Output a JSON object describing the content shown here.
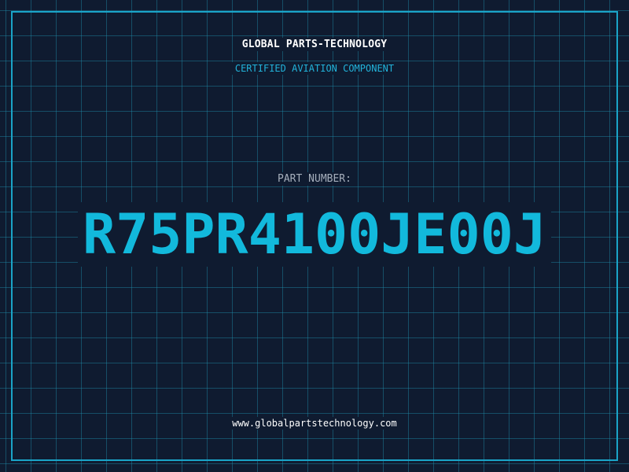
{
  "header": {
    "company": "GLOBAL PARTS-TECHNOLOGY",
    "subtitle": "CERTIFIED AVIATION COMPONENT"
  },
  "part": {
    "label": "PART NUMBER:",
    "number": "R75PR4100JE00J"
  },
  "footer": {
    "website": "www.globalpartstechnology.com"
  },
  "colors": {
    "background": "#0f1b30",
    "grid": "#1e8caa",
    "accent": "#12b9dc",
    "frame": "#1aa4c8",
    "label": "#a6afbc",
    "text": "#ffffff"
  }
}
